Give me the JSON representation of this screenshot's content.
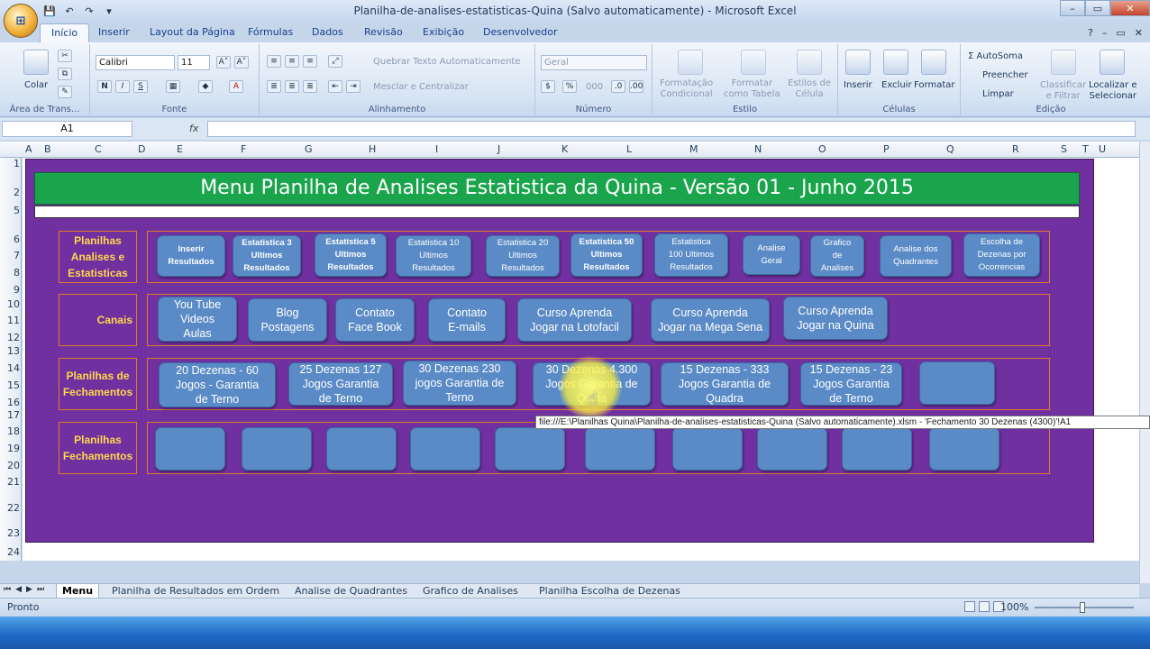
{
  "window": {
    "title": "Planilha-de-analises-estatisticas-Quina  (Salvo automaticamente) - Microsoft Excel",
    "controls": [
      "–",
      "▭",
      "✕"
    ]
  },
  "office_button": {
    "icon": "office-logo-icon",
    "glyph": "⊞"
  },
  "qat": [
    "💾",
    "↶",
    "↷",
    "▾"
  ],
  "ribbon_tabs": [
    "Início",
    "Inserir",
    "Layout da Página",
    "Fórmulas",
    "Dados",
    "Revisão",
    "Exibição",
    "Desenvolvedor"
  ],
  "help_icons": [
    "?",
    "–",
    "▭",
    "✕"
  ],
  "ribbon": {
    "clipboard": {
      "label": "Área de Trans...",
      "colar": "Colar"
    },
    "font": {
      "label": "Fonte",
      "family": "Calibri",
      "size": "11",
      "grow": "A˄",
      "shrink": "A˅",
      "bold": "N",
      "italic": "I",
      "underline": "S"
    },
    "alignment": {
      "label": "Alinhamento",
      "wrap": "Quebrar Texto Automaticamente",
      "merge": "Mesclar e Centralizar"
    },
    "number": {
      "label": "Número",
      "format": "Geral",
      "percent": "%",
      "thousands": "000"
    },
    "styles": {
      "label": "Estilo",
      "conditional": "Formatação\nCondicional",
      "table": "Formatar\ncomo Tabela",
      "cell": "Estilos de\nCélula"
    },
    "cells": {
      "label": "Células",
      "insert": "Inserir",
      "delete": "Excluir",
      "format": "Formatar"
    },
    "editing": {
      "label": "Edição",
      "autosum": "AutoSoma",
      "fill": "Preencher",
      "clear": "Limpar",
      "sort": "Classificar\ne Filtrar",
      "find": "Localizar e\nSelecionar"
    }
  },
  "formula_bar": {
    "name_box": "A1",
    "fx": "fx",
    "value": ""
  },
  "columns": [
    "A",
    "B",
    "C",
    "D",
    "E",
    "F",
    "G",
    "H",
    "I",
    "J",
    "K",
    "L",
    "M",
    "N",
    "O",
    "P",
    "Q",
    "R",
    "S",
    "T",
    "U"
  ],
  "rows": [
    "1",
    "2",
    "5",
    "6",
    "7",
    "8",
    "9",
    "10",
    "11",
    "12",
    "13",
    "14",
    "15",
    "16",
    "17",
    "18",
    "19",
    "20",
    "21",
    "22",
    "23",
    "24"
  ],
  "menu": {
    "banner": "Menu Planilha de Analises Estatistica da Quina - Versão 01 - Junho 2015",
    "sections": [
      {
        "label": "Planilhas\nAnalises e\nEstatisticas",
        "buttons": [
          "Inserir\nResultados",
          "Estatistica 3\nUltimos\nResultados",
          "Estatistica 5\nUltimos\nResultados",
          "Estatistica  10\nUltimos\nResultados",
          "Estatistica 20\nUltimos\nResultados",
          "Estatistica 50\nUltimos\nResultados",
          "Estatistica\n100 Ultimos\nResultados",
          "Analise\nGeral",
          "Grafico\nde\nAnalises",
          "Analise dos\nQuadrantes",
          "Escolha de\nDezenas por\nOcorrencias"
        ]
      },
      {
        "label": "Canais",
        "buttons": [
          "You Tube\nVideos\nAulas",
          "Blog\nPostagens",
          "Contato\nFace Book",
          "Contato\nE-mails",
          "Curso Aprenda\nJogar na Lotofacil",
          "Curso Aprenda\nJogar na Mega Sena",
          "Curso Aprenda\nJogar na Quina"
        ]
      },
      {
        "label": "Planilhas de\nFechamentos",
        "buttons": [
          "20 Dezenas  -  60\nJogos  - Garantia\nde Terno",
          "25 Dezenas  127\nJogos  Garantia\nde Terno",
          "30 Dezenas  230\njogos Garantia de\nTerno",
          "30 Dezenas 4.300\nJogos Garantia de\nQuina",
          "15 Dezenas - 333\nJogos Garantia de\nQuadra",
          "15 Dezenas - 23\nJogos Garantia\nde Terno",
          ""
        ]
      },
      {
        "label": "Planilhas\nFechamentos",
        "buttons": [
          "",
          "",
          "",
          "",
          "",
          "",
          "",
          "",
          "",
          ""
        ]
      }
    ]
  },
  "tooltip": "file:///E:\\Planilhas Quina\\Planilha-de-analises-estatisticas-Quina  (Salvo automaticamente).xlsm - 'Fechamento 30 Dezenas (4300)'!A1",
  "sheet_tabs": [
    "Menu",
    "Planilha de Resultados em Ordem",
    "Analise de Quadrantes",
    "Grafico de Analises",
    "Planilha Escolha de Dezenas"
  ],
  "sheet_nav": [
    "⏮",
    "◀",
    "▶",
    "⏭"
  ],
  "status": {
    "mode": "Pronto",
    "zoom": "100%"
  }
}
